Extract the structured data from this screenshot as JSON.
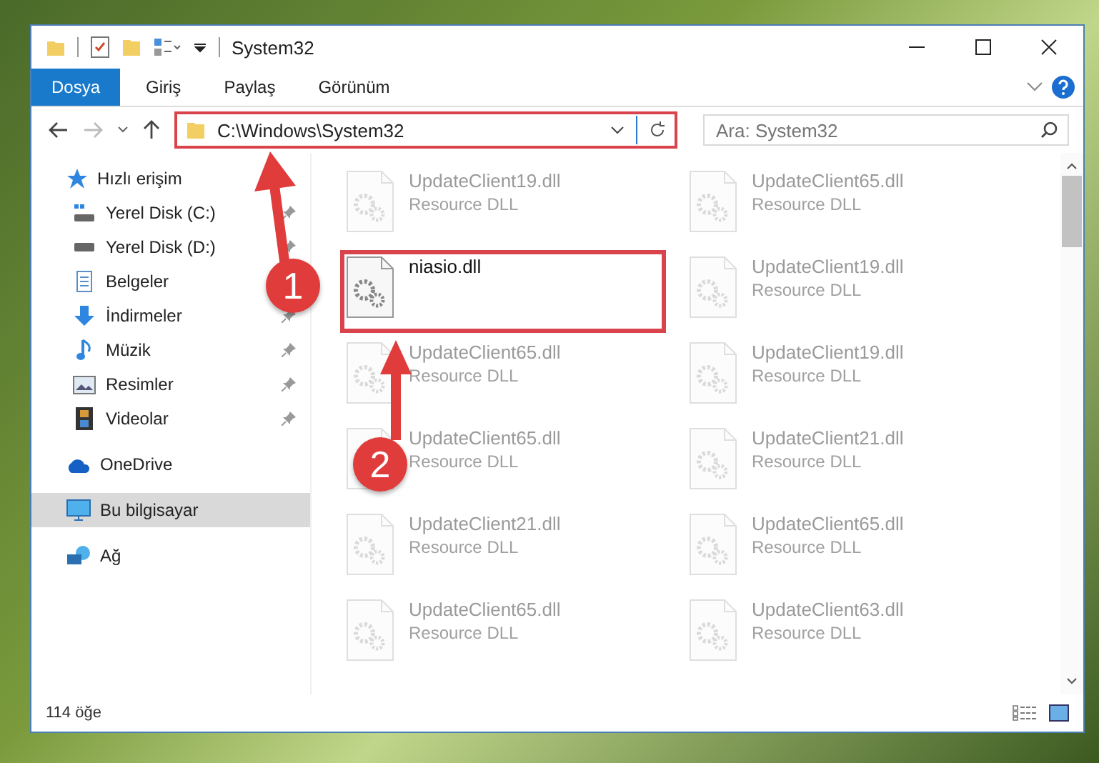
{
  "window": {
    "title": "System32"
  },
  "ribbon_tabs": [
    {
      "label": "Dosya",
      "selected": true
    },
    {
      "label": "Giriş",
      "selected": false
    },
    {
      "label": "Paylaş",
      "selected": false
    },
    {
      "label": "Görünüm",
      "selected": false
    }
  ],
  "address_bar": {
    "value": "C:\\Windows\\System32",
    "highlighted": true
  },
  "search": {
    "placeholder": "Ara: System32"
  },
  "sidebar": {
    "items": [
      {
        "label": "Hızlı erişim",
        "selected": false,
        "children": [
          {
            "label": "Yerel Disk (C:)",
            "pinned": true,
            "selected": false
          },
          {
            "label": "Yerel Disk (D:)",
            "pinned": true,
            "selected": false
          },
          {
            "label": "Belgeler",
            "selected": false
          },
          {
            "label": "İndirmeler",
            "pinned": true,
            "selected": false
          },
          {
            "label": "Müzik",
            "pinned": true,
            "selected": false
          },
          {
            "label": "Resimler",
            "pinned": true,
            "selected": false
          },
          {
            "label": "Videolar",
            "pinned": true,
            "selected": false
          }
        ]
      },
      {
        "label": "OneDrive",
        "selected": false
      },
      {
        "label": "Bu bilgisayar",
        "selected": true
      },
      {
        "label": "Ağ",
        "selected": false
      }
    ]
  },
  "files": [
    {
      "name": "UpdateClient19.dll",
      "type": "Resource DLL",
      "faded": true,
      "highlighted": false
    },
    {
      "name": "UpdateClient65.dll",
      "type": "Resource DLL",
      "faded": true,
      "highlighted": false
    },
    {
      "name": "niasio.dll",
      "faded": false,
      "highlighted": true
    },
    {
      "name": "UpdateClient19.dll",
      "type": "Resource DLL",
      "faded": true,
      "highlighted": false
    },
    {
      "name": "UpdateClient65.dll",
      "type": "Resource DLL",
      "faded": true,
      "highlighted": false
    },
    {
      "name": "UpdateClient19.dll",
      "type": "Resource DLL",
      "faded": true,
      "highlighted": false
    },
    {
      "name": "UpdateClient65.dll",
      "type": "Resource DLL",
      "faded": true,
      "highlighted": false
    },
    {
      "name": "UpdateClient21.dll",
      "type": "Resource DLL",
      "faded": true,
      "highlighted": false
    },
    {
      "name": "UpdateClient21.dll",
      "type": "Resource DLL",
      "faded": true,
      "highlighted": false
    },
    {
      "name": "UpdateClient65.dll",
      "type": "Resource DLL",
      "faded": true,
      "highlighted": false
    },
    {
      "name": "UpdateClient65.dll",
      "type": "Resource DLL",
      "faded": true,
      "highlighted": false
    },
    {
      "name": "UpdateClient63.dll",
      "type": "Resource DLL",
      "faded": true,
      "highlighted": false
    }
  ],
  "status_bar": {
    "item_count": "114 öğe"
  },
  "callouts": [
    {
      "number": "1"
    },
    {
      "number": "2"
    }
  ]
}
